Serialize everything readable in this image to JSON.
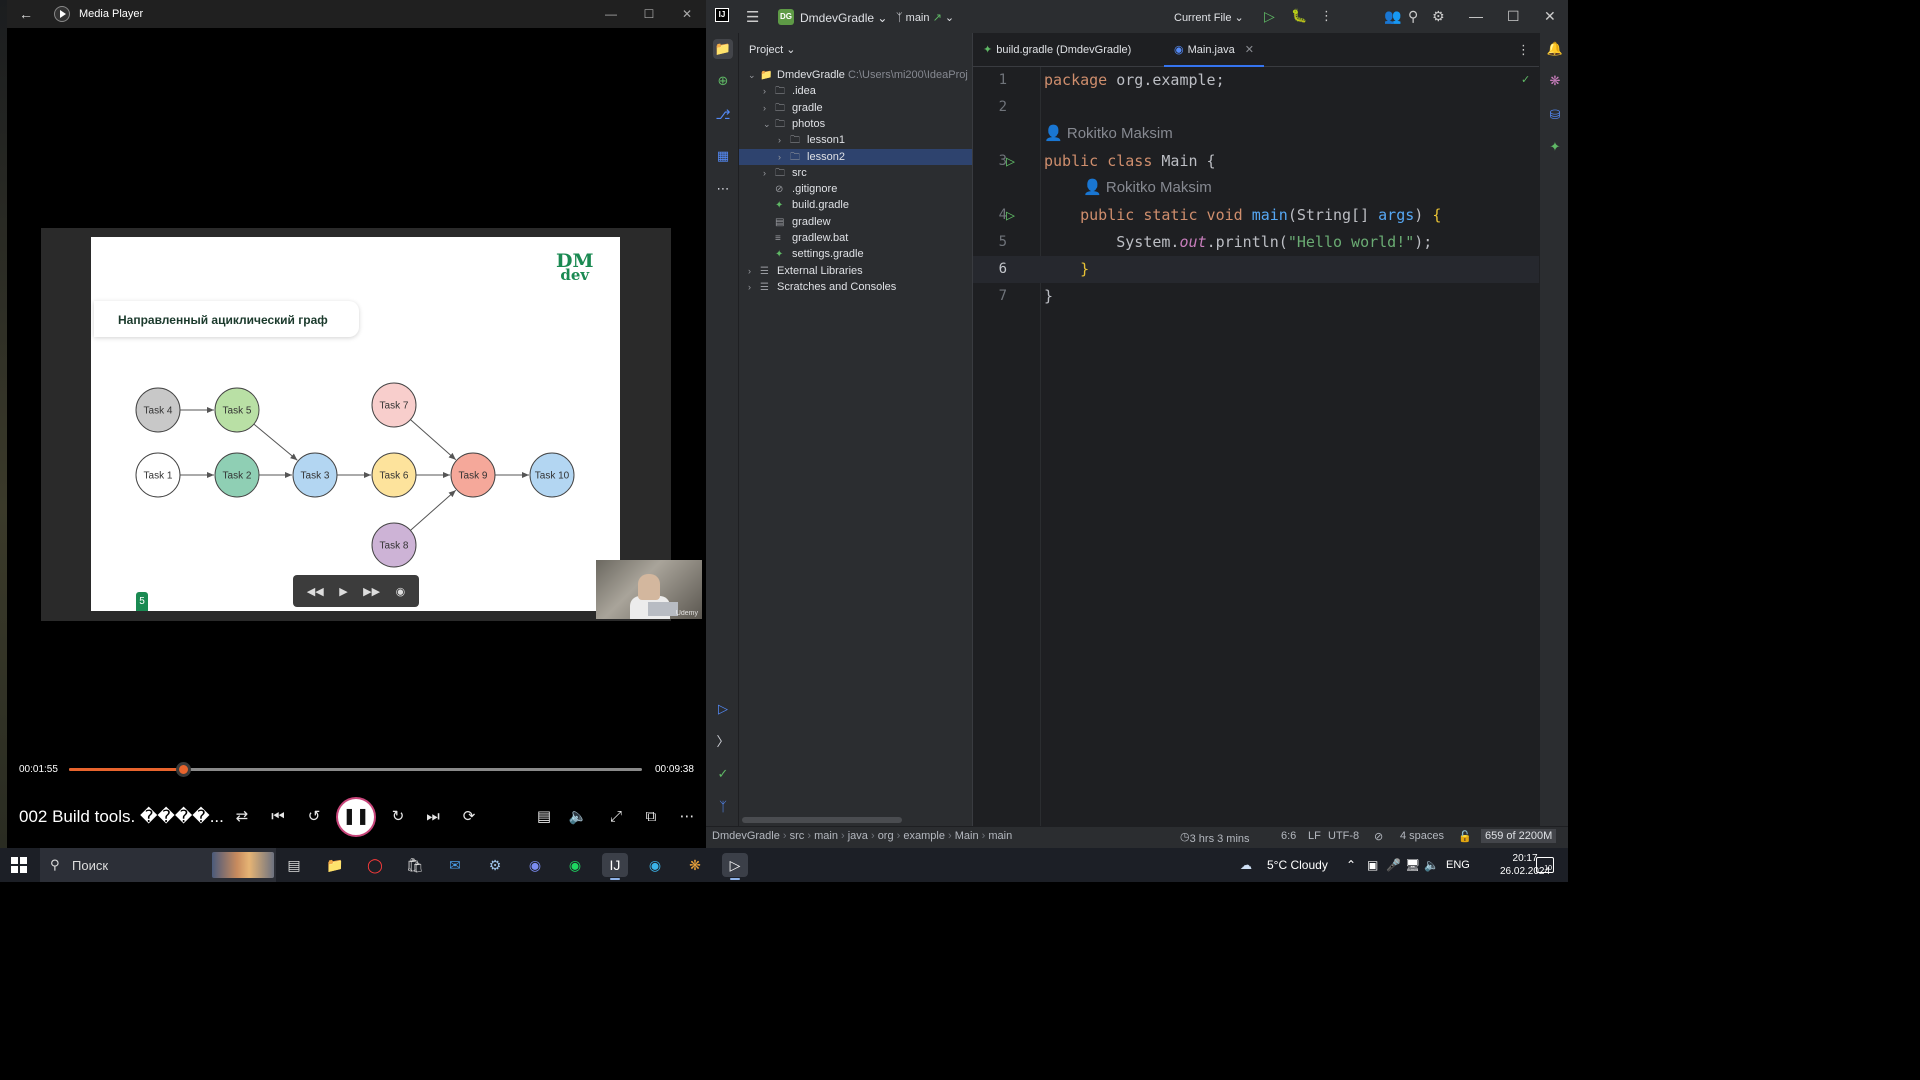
{
  "media_player": {
    "window_title": "Media Player",
    "slide": {
      "logo_line1": "DM",
      "logo_line2": "dev",
      "heading": "Направленный ациклический граф",
      "page_badge": "5",
      "nodes": [
        {
          "id": "t4",
          "label": "Task 4",
          "color": "#c8c8c8"
        },
        {
          "id": "t5",
          "label": "Task 5",
          "color": "#b9e0a5"
        },
        {
          "id": "t7",
          "label": "Task 7",
          "color": "#f8cecc"
        },
        {
          "id": "t1",
          "label": "Task 1",
          "color": "#ffffff"
        },
        {
          "id": "t2",
          "label": "Task 2",
          "color": "#8fcfb4"
        },
        {
          "id": "t3",
          "label": "Task 3",
          "color": "#b3d6f2"
        },
        {
          "id": "t6",
          "label": "Task 6",
          "color": "#fde39c"
        },
        {
          "id": "t9",
          "label": "Task 9",
          "color": "#f5a89a"
        },
        {
          "id": "t10",
          "label": "Task 10",
          "color": "#b3d6f2"
        },
        {
          "id": "t8",
          "label": "Task 8",
          "color": "#cdb3d6"
        }
      ],
      "edges": [
        [
          "t4",
          "t5"
        ],
        [
          "t5",
          "t3"
        ],
        [
          "t1",
          "t2"
        ],
        [
          "t2",
          "t3"
        ],
        [
          "t3",
          "t6"
        ],
        [
          "t6",
          "t9"
        ],
        [
          "t7",
          "t9"
        ],
        [
          "t8",
          "t9"
        ],
        [
          "t9",
          "t10"
        ]
      ]
    },
    "mini_controls": [
      "rewind-icon",
      "play-icon",
      "fast-forward-icon",
      "stop-icon"
    ],
    "webcam_watermark": "Udemy",
    "current_time": "00:01:55",
    "duration": "00:09:38",
    "progress_fraction": 0.1989,
    "video_title": "002 Build tools. ����...",
    "accent_color": "#e8642d"
  },
  "ide": {
    "project_badge": "DG",
    "project_name": "DmdevGradle",
    "branch": "main",
    "run_config": "Current File",
    "project_panel_title": "Project",
    "tree": [
      {
        "label": "DmdevGradle",
        "path": "C:\\Users\\mi200\\IdeaProj",
        "icon": "module-folder-icon",
        "depth": 0,
        "expanded": true
      },
      {
        "label": ".idea",
        "icon": "folder-icon",
        "depth": 1,
        "expanded": false
      },
      {
        "label": "gradle",
        "icon": "folder-icon",
        "depth": 1,
        "expanded": false
      },
      {
        "label": "photos",
        "icon": "folder-icon",
        "depth": 1,
        "expanded": true
      },
      {
        "label": "lesson1",
        "icon": "folder-icon",
        "depth": 2,
        "expanded": false
      },
      {
        "label": "lesson2",
        "icon": "folder-icon",
        "depth": 2,
        "expanded": false,
        "selected": true
      },
      {
        "label": "src",
        "icon": "folder-icon",
        "depth": 1,
        "expanded": false
      },
      {
        "label": ".gitignore",
        "icon": "ignore-file-icon",
        "depth": 1,
        "leaf": true
      },
      {
        "label": "build.gradle",
        "icon": "gradle-icon",
        "depth": 1,
        "leaf": true
      },
      {
        "label": "gradlew",
        "icon": "script-file-icon",
        "depth": 1,
        "leaf": true
      },
      {
        "label": "gradlew.bat",
        "icon": "text-file-icon",
        "depth": 1,
        "leaf": true
      },
      {
        "label": "settings.gradle",
        "icon": "gradle-icon",
        "depth": 1,
        "leaf": true
      },
      {
        "label": "External Libraries",
        "icon": "library-icon",
        "depth": 0,
        "expanded": false
      },
      {
        "label": "Scratches and Consoles",
        "icon": "scratches-icon",
        "depth": 0,
        "expanded": false
      }
    ],
    "tabs": [
      {
        "label": "build.gradle (DmdevGradle)",
        "icon": "gradle-icon",
        "active": false
      },
      {
        "label": "Main.java",
        "icon": "class-icon",
        "active": true
      }
    ],
    "author": "Rokitko Maksim",
    "code_lines": [
      {
        "num": "1",
        "text": "package org.example;"
      },
      {
        "num": "2",
        "text": ""
      },
      {
        "num": "3",
        "text": "public class Main {"
      },
      {
        "num": "4",
        "text": "    public static void main(String[] args) {"
      },
      {
        "num": "5",
        "text": "        System.out.println(\"Hello world!\");"
      },
      {
        "num": "6",
        "text": "    }"
      },
      {
        "num": "7",
        "text": "}"
      }
    ],
    "breadcrumb": [
      "DmdevGradle",
      "src",
      "main",
      "java",
      "org",
      "example",
      "Main",
      "main"
    ],
    "status": {
      "time_tracking": "3 hrs 3 mins",
      "caret": "6:6",
      "line_sep": "LF",
      "encoding": "UTF-8",
      "indent": "4 spaces",
      "memory": "659 of 2200M"
    }
  },
  "taskbar": {
    "search_label": "Поиск",
    "weather": "5°C  Cloudy",
    "language": "ENG",
    "time": "20:17",
    "date": "26.02.2024",
    "notifications": "10"
  }
}
